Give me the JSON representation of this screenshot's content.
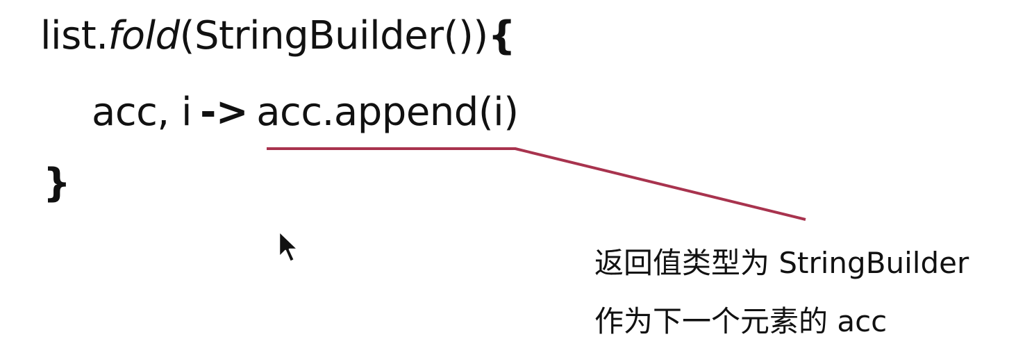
{
  "code": {
    "line1": {
      "prefix": "list.",
      "method": "fold",
      "args": "(StringBuilder())",
      "brace": "{"
    },
    "line2": {
      "params": "acc, i",
      "arrow": "->",
      "body": "acc.append(i)"
    },
    "line3": {
      "brace": "}"
    }
  },
  "annotation": {
    "line1": "返回值类型为 StringBuilder",
    "line2": "作为下一个元素的 acc",
    "connector_color": "#a8334e"
  },
  "cursor": {
    "icon": "arrow-cursor-icon"
  }
}
